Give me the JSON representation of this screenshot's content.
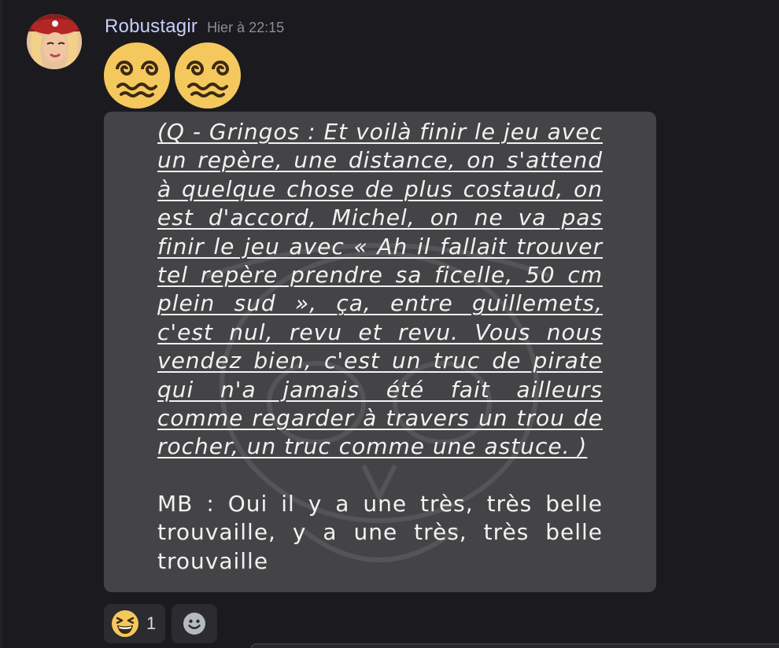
{
  "message": {
    "author": "Robustagir",
    "timestamp": "Hier à 22:15",
    "emojis": [
      "woozy-face",
      "woozy-face"
    ],
    "image_text": {
      "question": "(Q - Gringos : Et voilà finir le jeu avec un repère, une distance, on s'attend à quelque chose de plus costaud, on est d'accord, Michel, on ne va pas finir le jeu avec « Ah il fallait trouver tel repère prendre sa ficelle, 50 cm plein sud », ça, entre guillemets, c'est nul, revu et revu. Vous nous vendez bien, c'est un truc de pirate qui n'a jamais été fait ailleurs comme regarder à travers un trou de rocher, un truc comme une astuce. )",
      "answer": "MB : Oui il y a une très, très belle trouvaille, y a une très, très belle trouvaille"
    }
  },
  "reactions": [
    {
      "emoji": "laughing-squint-face",
      "count": "1"
    }
  ],
  "colors": {
    "background": "#1b1b1f",
    "author": "#c9cdfb",
    "timestamp": "#8c8d96",
    "card": "#444446",
    "reaction_bg": "#2b2b30"
  }
}
